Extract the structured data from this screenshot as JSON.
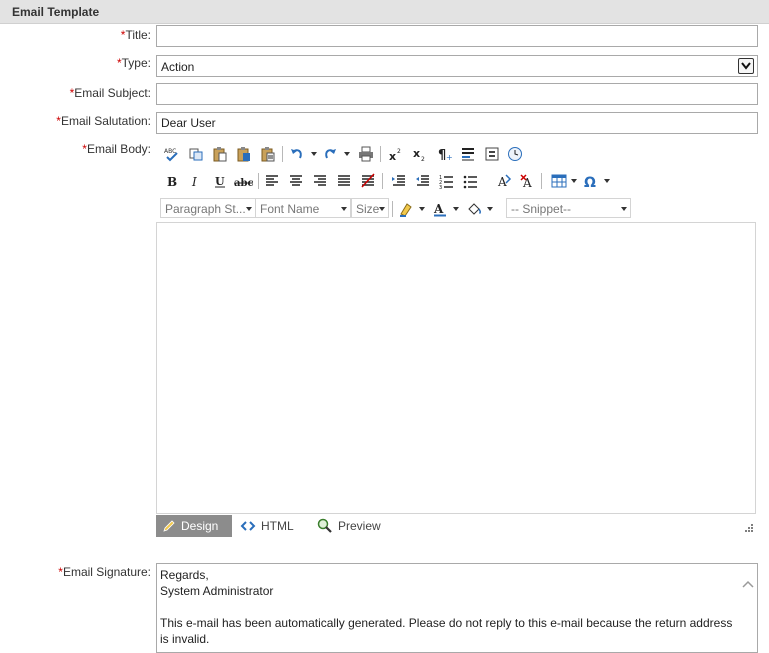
{
  "section": {
    "title": "Email Template"
  },
  "form": {
    "required_marker": "*",
    "title_label": "Title:",
    "title_value": "",
    "type_label": "Type:",
    "type_value": "Action",
    "subject_label": "Email Subject:",
    "subject_value": "",
    "salutation_label": "Email Salutation:",
    "salutation_value": "Dear User",
    "body_label": "Email Body:",
    "signature_label": "Email Signature:"
  },
  "editor": {
    "paragraph_style": "Paragraph St...",
    "font_name": "Font Name",
    "size": "Size",
    "snippet": "-- Snippet--",
    "modes": {
      "design": "Design",
      "html": "HTML",
      "preview": "Preview"
    },
    "accent_color": "#2a6ebb"
  },
  "signature": {
    "lines": [
      "Regards,",
      "System Administrator",
      "",
      "This e-mail has been automatically generated. Please do not reply to this e-mail because the return address is invalid."
    ]
  }
}
